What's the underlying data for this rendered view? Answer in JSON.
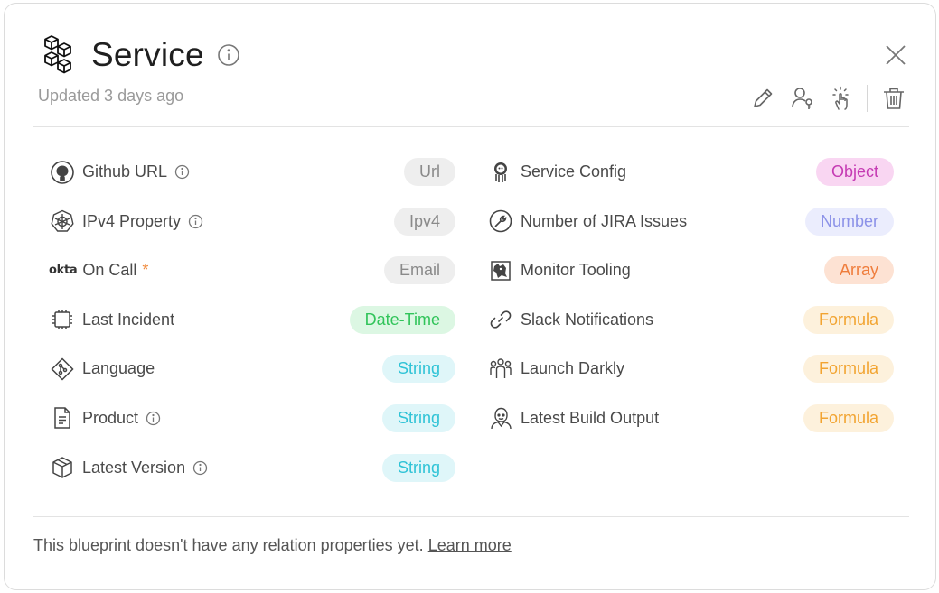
{
  "header": {
    "title": "Service",
    "updated": "Updated 3 days ago",
    "icons": [
      "blueprint-cubes-icon",
      "info-icon",
      "close-icon"
    ],
    "toolbar": [
      "edit-icon",
      "permissions-icon",
      "actions-icon",
      "delete-icon"
    ]
  },
  "properties_left": [
    {
      "name": "Github URL",
      "type": "Url",
      "icon": "github-icon",
      "info": true
    },
    {
      "name": "IPv4 Property",
      "type": "Ipv4",
      "icon": "kubernetes-icon",
      "info": true
    },
    {
      "name": "On Call",
      "type": "Email",
      "icon": "okta-logo",
      "logo_text": "okta",
      "required": "*"
    },
    {
      "name": "Last Incident",
      "type": "Date-Time",
      "icon": "chip-icon"
    },
    {
      "name": "Language",
      "type": "String",
      "icon": "git-icon"
    },
    {
      "name": "Product",
      "type": "String",
      "icon": "document-icon",
      "info": true
    },
    {
      "name": "Latest Version",
      "type": "String",
      "icon": "package-icon",
      "info": true
    }
  ],
  "properties_right": [
    {
      "name": "Service Config",
      "type": "Object",
      "icon": "argo-icon"
    },
    {
      "name": "Number of JIRA Issues",
      "type": "Number",
      "icon": "wrench-icon"
    },
    {
      "name": "Monitor Tooling",
      "type": "Array",
      "icon": "datadog-icon"
    },
    {
      "name": "Slack Notifications",
      "type": "Formula",
      "icon": "link-icon"
    },
    {
      "name": "Launch Darkly",
      "type": "Formula",
      "icon": "team-icon"
    },
    {
      "name": "Latest Build Output",
      "type": "Formula",
      "icon": "jenkins-icon"
    }
  ],
  "type_colors": {
    "Url": {
      "bg": "#eeeeee",
      "fg": "#8a8a8a"
    },
    "Ipv4": {
      "bg": "#eeeeee",
      "fg": "#8a8a8a"
    },
    "Email": {
      "bg": "#eeeeee",
      "fg": "#8a8a8a"
    },
    "Date-Time": {
      "bg": "#dcf7e3",
      "fg": "#31c45a"
    },
    "String": {
      "bg": "#dff6f9",
      "fg": "#2fc3d6"
    },
    "Object": {
      "bg": "#f9d6f2",
      "fg": "#c53ab3"
    },
    "Number": {
      "bg": "#ebedfd",
      "fg": "#8c92e8"
    },
    "Array": {
      "bg": "#fde2d3",
      "fg": "#ef7d3c"
    },
    "Formula": {
      "bg": "#fdf1dc",
      "fg": "#f2a431"
    }
  },
  "footer": {
    "text": "This blueprint doesn't have any relation properties yet.",
    "link": "Learn more"
  }
}
